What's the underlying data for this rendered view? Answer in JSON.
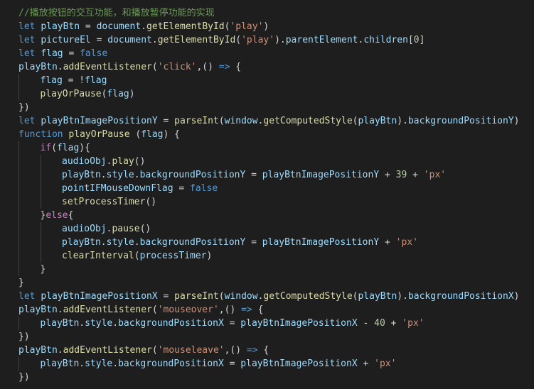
{
  "colors": {
    "background": "#1e1e1e",
    "comment": "#6a9955",
    "keyword": "#569cd6",
    "control": "#c586c0",
    "variable": "#9cdcfe",
    "function": "#dcdcaa",
    "string": "#ce9178",
    "number": "#b5cea8",
    "operator": "#d4d4d4"
  },
  "code": {
    "lines": [
      {
        "indent": 0,
        "tokens": [
          [
            "comment",
            "//播放按钮的交互功能，和播放暂停功能的实现"
          ]
        ]
      },
      {
        "indent": 0,
        "tokens": [
          [
            "kw",
            "let"
          ],
          [
            "op",
            " "
          ],
          [
            "var",
            "playBtn"
          ],
          [
            "op",
            " = "
          ],
          [
            "var",
            "document"
          ],
          [
            "op",
            "."
          ],
          [
            "fn",
            "getElementById"
          ],
          [
            "op",
            "("
          ],
          [
            "str",
            "'play'"
          ],
          [
            "op",
            ")"
          ]
        ]
      },
      {
        "indent": 0,
        "tokens": [
          [
            "kw",
            "let"
          ],
          [
            "op",
            " "
          ],
          [
            "var",
            "pictureEl"
          ],
          [
            "op",
            " = "
          ],
          [
            "var",
            "document"
          ],
          [
            "op",
            "."
          ],
          [
            "fn",
            "getElementById"
          ],
          [
            "op",
            "("
          ],
          [
            "str",
            "'play'"
          ],
          [
            "op",
            ")."
          ],
          [
            "var",
            "parentElement"
          ],
          [
            "op",
            "."
          ],
          [
            "var",
            "children"
          ],
          [
            "op",
            "["
          ],
          [
            "num",
            "0"
          ],
          [
            "op",
            "]"
          ]
        ]
      },
      {
        "indent": 0,
        "tokens": [
          [
            "kw",
            "let"
          ],
          [
            "op",
            " "
          ],
          [
            "var",
            "flag"
          ],
          [
            "op",
            " = "
          ],
          [
            "kw",
            "false"
          ]
        ]
      },
      {
        "indent": 0,
        "tokens": [
          [
            "var",
            "playBtn"
          ],
          [
            "op",
            "."
          ],
          [
            "fn",
            "addEventListener"
          ],
          [
            "op",
            "("
          ],
          [
            "str",
            "'click'"
          ],
          [
            "op",
            ",() "
          ],
          [
            "kw",
            "=>"
          ],
          [
            "op",
            " {"
          ]
        ]
      },
      {
        "indent": 1,
        "tokens": [
          [
            "var",
            "flag"
          ],
          [
            "op",
            " = !"
          ],
          [
            "var",
            "flag"
          ]
        ]
      },
      {
        "indent": 1,
        "tokens": [
          [
            "fn",
            "playOrPause"
          ],
          [
            "op",
            "("
          ],
          [
            "var",
            "flag"
          ],
          [
            "op",
            ")"
          ]
        ]
      },
      {
        "indent": 0,
        "tokens": [
          [
            "op",
            "})"
          ]
        ]
      },
      {
        "indent": 0,
        "tokens": [
          [
            "kw",
            "let"
          ],
          [
            "op",
            " "
          ],
          [
            "var",
            "playBtnImagePositionY"
          ],
          [
            "op",
            " = "
          ],
          [
            "fn",
            "parseInt"
          ],
          [
            "op",
            "("
          ],
          [
            "var",
            "window"
          ],
          [
            "op",
            "."
          ],
          [
            "fn",
            "getComputedStyle"
          ],
          [
            "op",
            "("
          ],
          [
            "var",
            "playBtn"
          ],
          [
            "op",
            ")."
          ],
          [
            "var",
            "backgroundPositionY"
          ],
          [
            "op",
            ")"
          ]
        ]
      },
      {
        "indent": 0,
        "tokens": [
          [
            "kw",
            "function"
          ],
          [
            "op",
            " "
          ],
          [
            "fn",
            "playOrPause"
          ],
          [
            "op",
            " ("
          ],
          [
            "var",
            "flag"
          ],
          [
            "op",
            ") {"
          ]
        ]
      },
      {
        "indent": 1,
        "tokens": [
          [
            "ctrl",
            "if"
          ],
          [
            "op",
            "("
          ],
          [
            "var",
            "flag"
          ],
          [
            "op",
            "){"
          ]
        ]
      },
      {
        "indent": 2,
        "tokens": [
          [
            "var",
            "audioObj"
          ],
          [
            "op",
            "."
          ],
          [
            "fn",
            "play"
          ],
          [
            "op",
            "()"
          ]
        ]
      },
      {
        "indent": 2,
        "tokens": [
          [
            "var",
            "playBtn"
          ],
          [
            "op",
            "."
          ],
          [
            "var",
            "style"
          ],
          [
            "op",
            "."
          ],
          [
            "var",
            "backgroundPositionY"
          ],
          [
            "op",
            " = "
          ],
          [
            "var",
            "playBtnImagePositionY"
          ],
          [
            "op",
            " + "
          ],
          [
            "num",
            "39"
          ],
          [
            "op",
            " + "
          ],
          [
            "str",
            "'px'"
          ]
        ]
      },
      {
        "indent": 2,
        "tokens": [
          [
            "var",
            "pointIFMouseDownFlag"
          ],
          [
            "op",
            " = "
          ],
          [
            "kw",
            "false"
          ]
        ]
      },
      {
        "indent": 2,
        "tokens": [
          [
            "fn",
            "setProcessTimer"
          ],
          [
            "op",
            "()"
          ]
        ]
      },
      {
        "indent": 1,
        "tokens": [
          [
            "op",
            "}"
          ],
          [
            "ctrl",
            "else"
          ],
          [
            "op",
            "{"
          ]
        ]
      },
      {
        "indent": 2,
        "tokens": [
          [
            "var",
            "audioObj"
          ],
          [
            "op",
            "."
          ],
          [
            "fn",
            "pause"
          ],
          [
            "op",
            "()"
          ]
        ]
      },
      {
        "indent": 2,
        "tokens": [
          [
            "var",
            "playBtn"
          ],
          [
            "op",
            "."
          ],
          [
            "var",
            "style"
          ],
          [
            "op",
            "."
          ],
          [
            "var",
            "backgroundPositionY"
          ],
          [
            "op",
            " = "
          ],
          [
            "var",
            "playBtnImagePositionY"
          ],
          [
            "op",
            " + "
          ],
          [
            "str",
            "'px'"
          ]
        ]
      },
      {
        "indent": 2,
        "tokens": [
          [
            "fn",
            "clearInterval"
          ],
          [
            "op",
            "("
          ],
          [
            "var",
            "processTimer"
          ],
          [
            "op",
            ")"
          ]
        ]
      },
      {
        "indent": 1,
        "tokens": [
          [
            "op",
            "}"
          ]
        ]
      },
      {
        "indent": 0,
        "tokens": [
          [
            "op",
            "}"
          ]
        ]
      },
      {
        "indent": 0,
        "tokens": [
          [
            "kw",
            "let"
          ],
          [
            "op",
            " "
          ],
          [
            "var",
            "playBtnImagePositionX"
          ],
          [
            "op",
            " = "
          ],
          [
            "fn",
            "parseInt"
          ],
          [
            "op",
            "("
          ],
          [
            "var",
            "window"
          ],
          [
            "op",
            "."
          ],
          [
            "fn",
            "getComputedStyle"
          ],
          [
            "op",
            "("
          ],
          [
            "var",
            "playBtn"
          ],
          [
            "op",
            ")."
          ],
          [
            "var",
            "backgroundPositionX"
          ],
          [
            "op",
            ")"
          ]
        ]
      },
      {
        "indent": 0,
        "tokens": [
          [
            "var",
            "playBtn"
          ],
          [
            "op",
            "."
          ],
          [
            "fn",
            "addEventListener"
          ],
          [
            "op",
            "("
          ],
          [
            "str",
            "'mouseover'"
          ],
          [
            "op",
            ",() "
          ],
          [
            "kw",
            "=>"
          ],
          [
            "op",
            " {"
          ]
        ]
      },
      {
        "indent": 1,
        "tokens": [
          [
            "var",
            "playBtn"
          ],
          [
            "op",
            "."
          ],
          [
            "var",
            "style"
          ],
          [
            "op",
            "."
          ],
          [
            "var",
            "backgroundPositionX"
          ],
          [
            "op",
            " = "
          ],
          [
            "var",
            "playBtnImagePositionX"
          ],
          [
            "op",
            " - "
          ],
          [
            "num",
            "40"
          ],
          [
            "op",
            " + "
          ],
          [
            "str",
            "'px'"
          ]
        ]
      },
      {
        "indent": 0,
        "tokens": [
          [
            "op",
            "})"
          ]
        ]
      },
      {
        "indent": 0,
        "tokens": [
          [
            "var",
            "playBtn"
          ],
          [
            "op",
            "."
          ],
          [
            "fn",
            "addEventListener"
          ],
          [
            "op",
            "("
          ],
          [
            "str",
            "'mouseleave'"
          ],
          [
            "op",
            ",() "
          ],
          [
            "kw",
            "=>"
          ],
          [
            "op",
            " {"
          ]
        ]
      },
      {
        "indent": 1,
        "tokens": [
          [
            "var",
            "playBtn"
          ],
          [
            "op",
            "."
          ],
          [
            "var",
            "style"
          ],
          [
            "op",
            "."
          ],
          [
            "var",
            "backgroundPositionX"
          ],
          [
            "op",
            " = "
          ],
          [
            "var",
            "playBtnImagePositionX"
          ],
          [
            "op",
            " + "
          ],
          [
            "str",
            "'px'"
          ]
        ]
      },
      {
        "indent": 0,
        "tokens": [
          [
            "op",
            "})"
          ]
        ]
      }
    ]
  }
}
